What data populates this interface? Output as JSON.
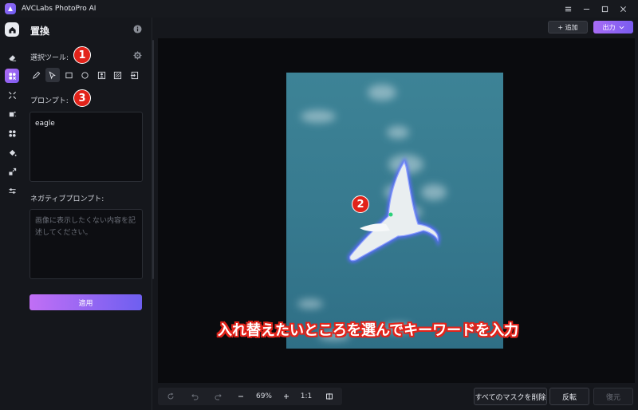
{
  "app": {
    "title": "AVCLabs PhotoPro AI"
  },
  "panel": {
    "title": "置換",
    "selection_tool_label": "選択ツール:",
    "prompt_label": "プロンプト:",
    "prompt_value": "eagle",
    "negative_prompt_label": "ネガティブプロンプト:",
    "negative_prompt_placeholder": "画像に表示したくない内容を記述してください。",
    "apply_label": "適用"
  },
  "toolbar": {
    "add_label": "+ 追加",
    "export_label": "出力"
  },
  "badges": {
    "one": "1",
    "two": "2",
    "three": "3"
  },
  "caption": "入れ替えたいところを選んでキーワードを入力",
  "zoom": {
    "level": "69%",
    "ratio": "1:1"
  },
  "bottom": {
    "delete_masks_label": "すべてのマスクを削除",
    "invert_label": "反転",
    "restore_label": "復元"
  },
  "colors": {
    "accent": "#8b5cf6",
    "badge": "#e2231a",
    "sky": "#3b7c92"
  }
}
